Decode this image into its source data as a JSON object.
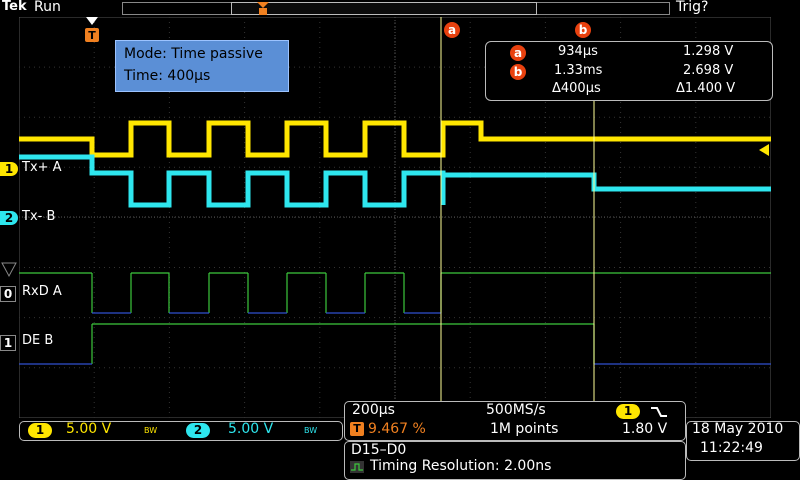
{
  "header": {
    "brand": "Tek",
    "acq_state": "Run",
    "trigger_state": "Trig?"
  },
  "channels": [
    {
      "marker": "1",
      "label": "Tx+ A",
      "color": "#ffe600"
    },
    {
      "marker": "2",
      "label": "Tx- B",
      "color": "#2ee6ee"
    },
    {
      "marker": "0",
      "label": "RxD A",
      "color": "#3cc83c"
    },
    {
      "marker": "1",
      "label": "DE B",
      "color": "#3cc83c"
    }
  ],
  "mode_box": {
    "line1": "Mode: Time passive",
    "line2": "Time:  400µs"
  },
  "cursors": {
    "a_label": "a",
    "b_label": "b",
    "a_time": "934µs",
    "a_value": "1.298 V",
    "b_time": "1.33ms",
    "b_value": "2.698 V",
    "delta_time": "Δ400µs",
    "delta_value": "Δ1.400 V"
  },
  "trigger_marker": "T",
  "bottom_left": {
    "ch1_num": "1",
    "ch1_scale": "5.00 V",
    "ch1_bw": "BW",
    "ch2_num": "2",
    "ch2_scale": "5.00 V",
    "ch2_bw": "BW"
  },
  "timebase": {
    "horizontal_scale": "200µs",
    "sample_rate": "500MS/s",
    "trigger_pos": "9.467 %",
    "record_length": "1M points",
    "trigger_ch": "1",
    "trigger_level": "1.80 V",
    "trigger_slope": "falling-edge-icon"
  },
  "digital": {
    "channels": "D15–D0",
    "timing_resolution": "Timing Resolution: 2.00ns"
  },
  "datetime": {
    "date": "18 May 2010",
    "time": "11:22:49"
  },
  "colors": {
    "ch1": "#ffe600",
    "ch2": "#2ee6ee",
    "digital_high": "#3cc83c",
    "digital_low": "#3050d0",
    "cursor": "#ffff99",
    "cursor_badge": "#e8410f",
    "mode_box": "#5b8fd6"
  }
}
